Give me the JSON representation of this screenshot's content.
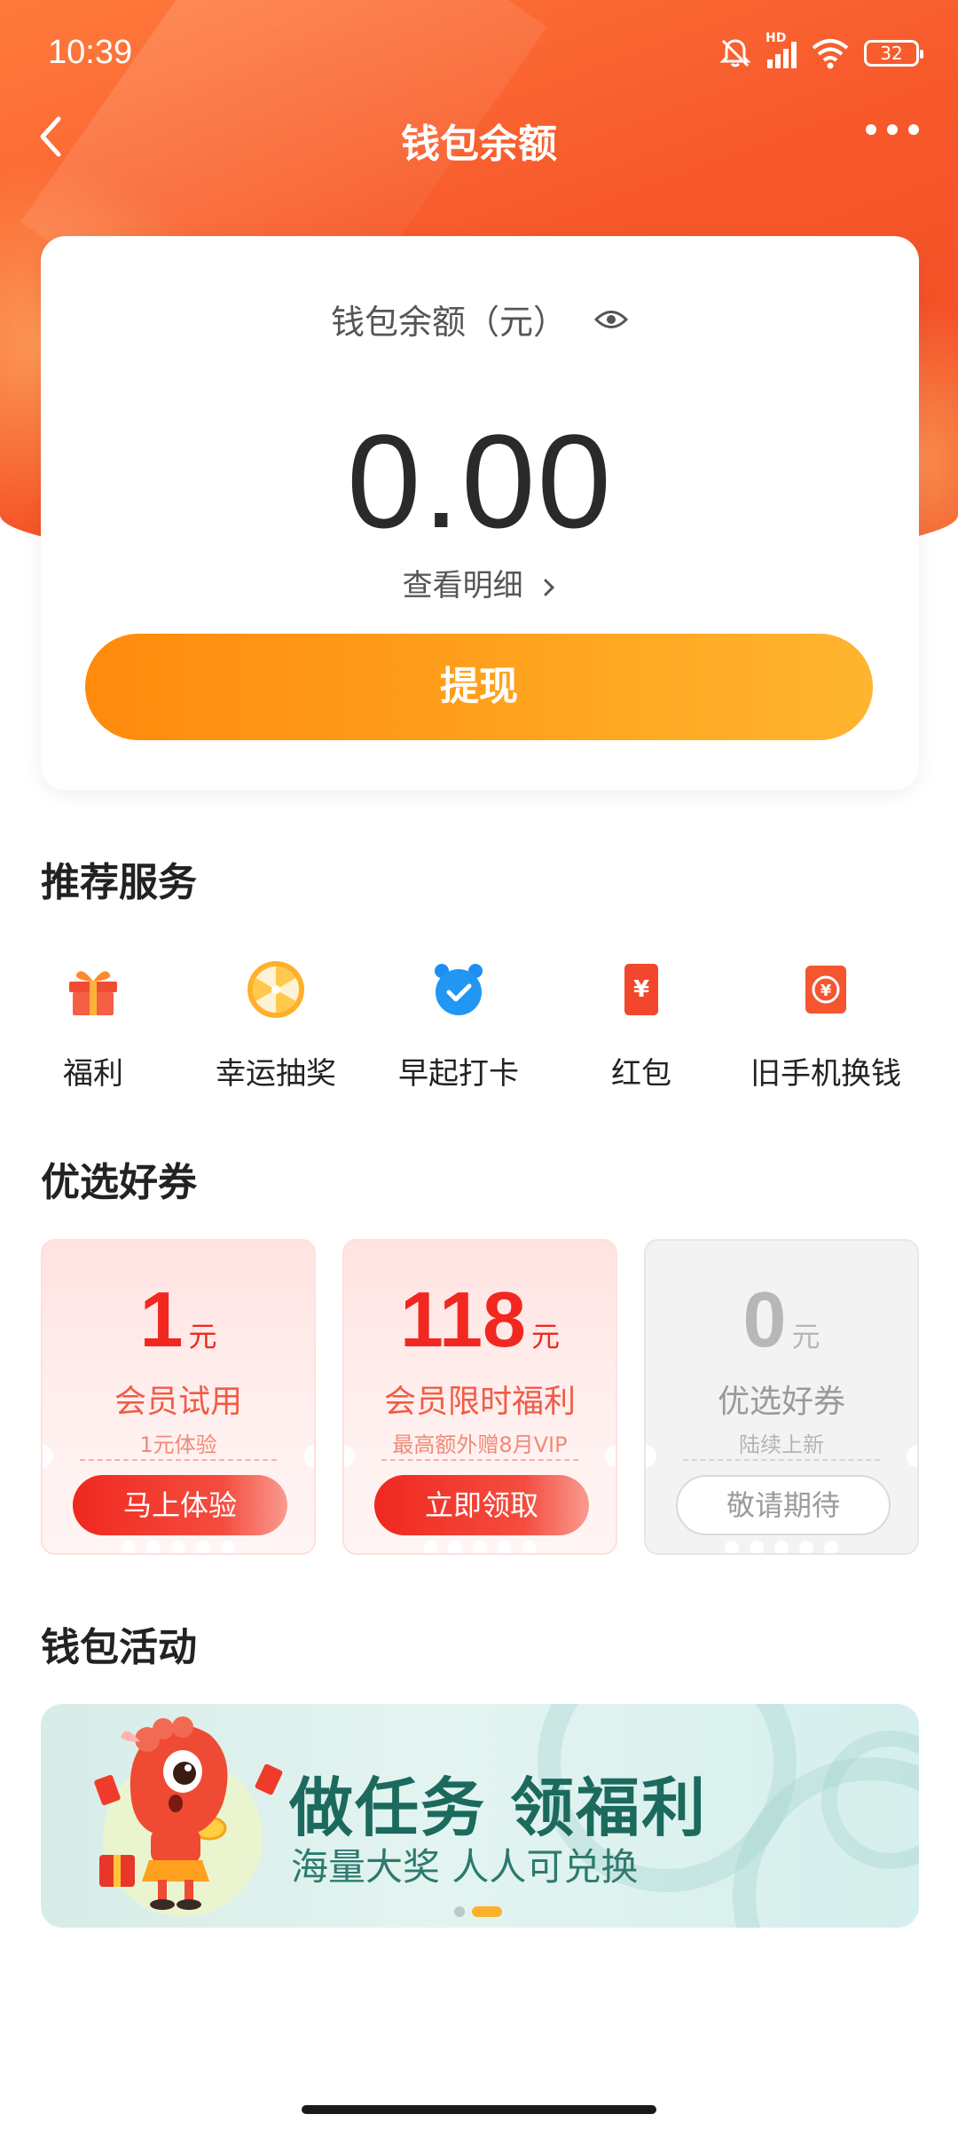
{
  "status_bar": {
    "time": "10:39",
    "network_label": "HD",
    "battery": "32"
  },
  "nav": {
    "title": "钱包余额"
  },
  "balance": {
    "label": "钱包余额（元）",
    "amount": "0.00",
    "detail_link": "查看明细",
    "withdraw_label": "提现"
  },
  "services": {
    "title": "推荐服务",
    "items": [
      {
        "label": "福利",
        "icon": "gift-icon"
      },
      {
        "label": "幸运抽奖",
        "icon": "lucky-wheel-icon"
      },
      {
        "label": "早起打卡",
        "icon": "alarm-clock-icon"
      },
      {
        "label": "红包",
        "icon": "red-envelope-icon"
      },
      {
        "label": "旧手机换钱",
        "icon": "phone-trade-in-icon"
      }
    ]
  },
  "coupons": {
    "title": "优选好券",
    "items": [
      {
        "amount": "1",
        "unit": "元",
        "name": "会员试用",
        "sub": "1元体验",
        "button": "马上体验",
        "state": "active"
      },
      {
        "amount": "118",
        "unit": "元",
        "name": "会员限时福利",
        "sub": "最高额外赠8月VIP",
        "button": "立即领取",
        "state": "active"
      },
      {
        "amount": "0",
        "unit": "元",
        "name": "优选好券",
        "sub": "陆续上新",
        "button": "敬请期待",
        "state": "disabled"
      }
    ]
  },
  "activities": {
    "title": "钱包活动",
    "banner_title": "做任务 领福利",
    "banner_subtitle": "海量大奖 人人可兑换",
    "banner_page_count": 2,
    "banner_active_index": 1
  },
  "colors": {
    "header": "#f7592b",
    "withdraw_start": "#ff8a0c",
    "withdraw_end": "#ffb52f",
    "coupon_red": "#f2271f",
    "banner_text": "#1c6a5e"
  }
}
